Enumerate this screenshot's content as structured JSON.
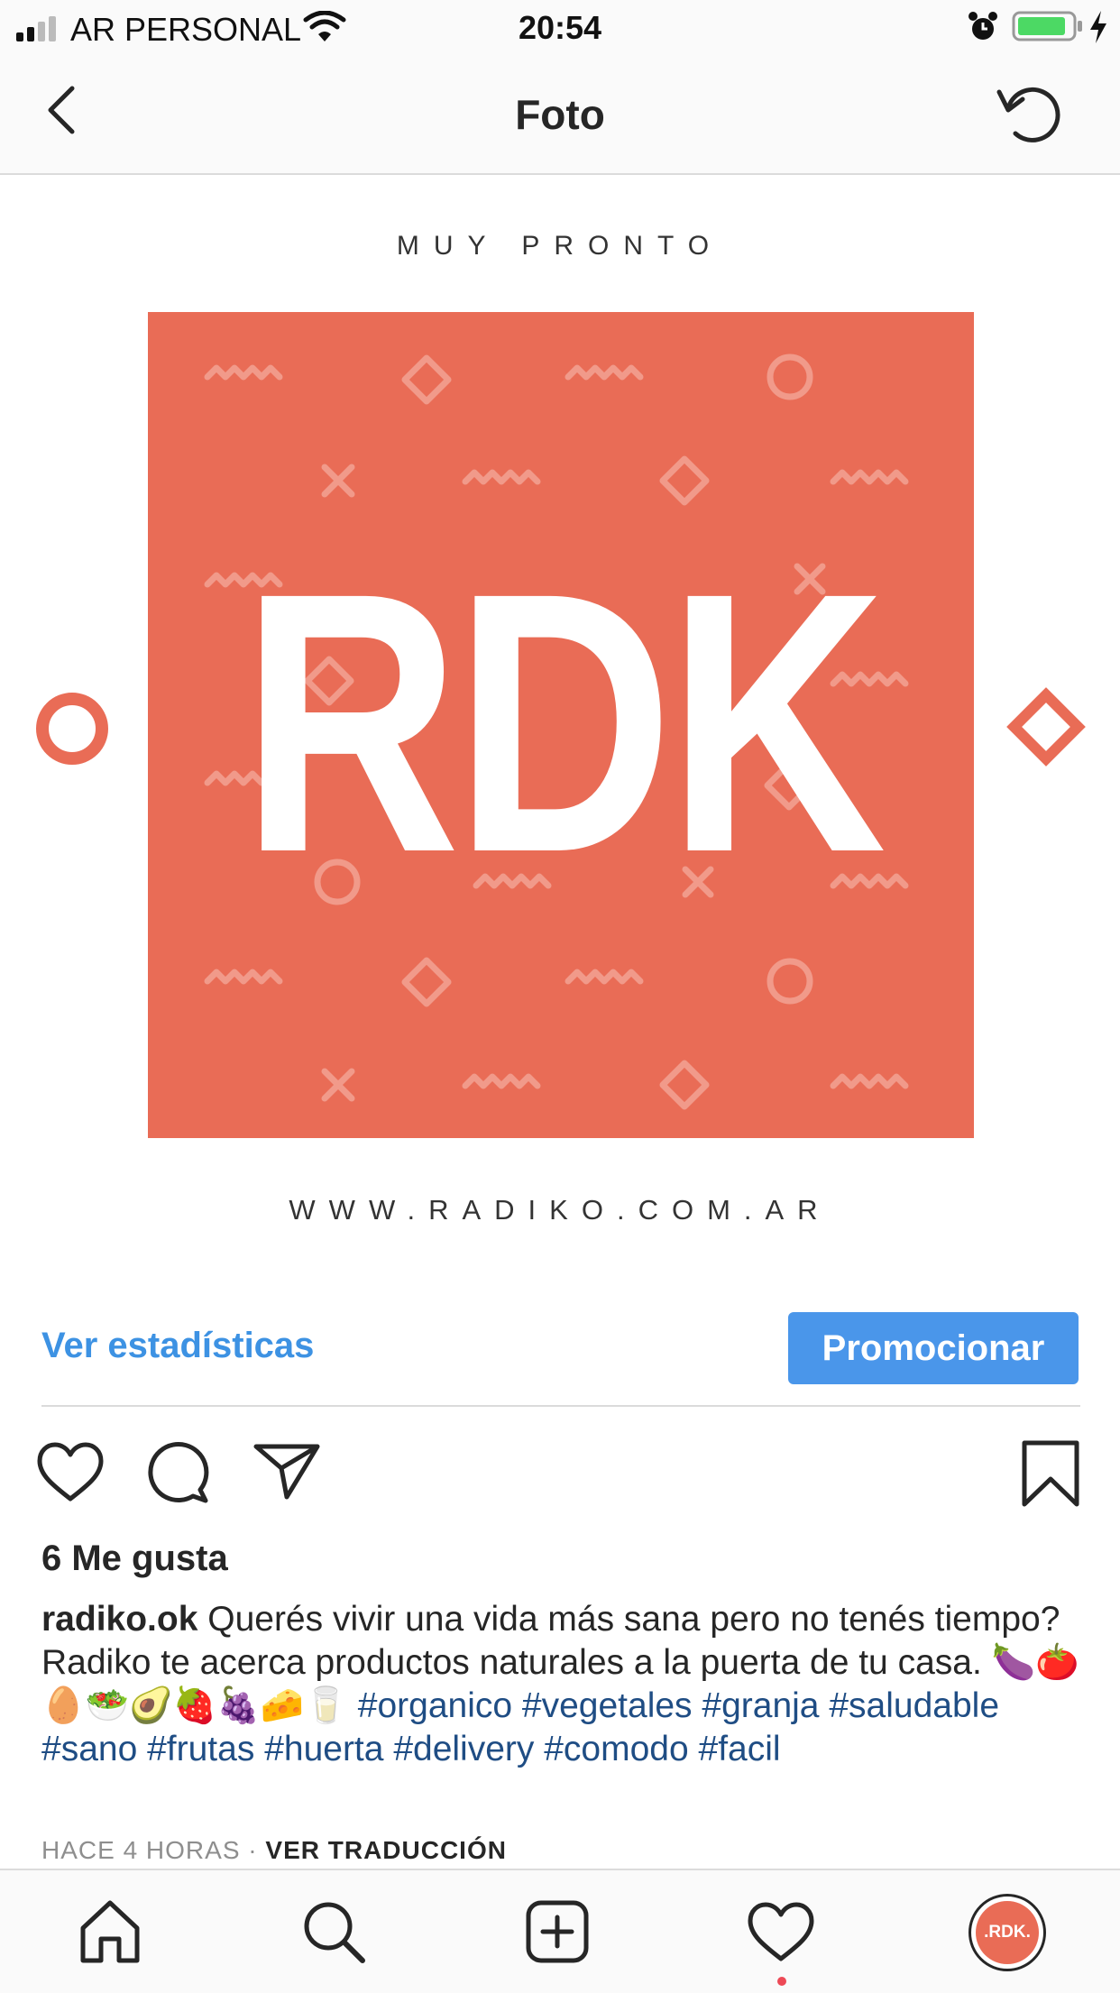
{
  "status_bar": {
    "carrier": "AR PERSONAL",
    "time": "20:54"
  },
  "header": {
    "title": "Foto"
  },
  "post_image": {
    "top_text": "MUY PRONTO",
    "logo_text": "RDK",
    "bottom_text": "WWW.RADIKO.COM.AR",
    "brand_color": "#e96c56"
  },
  "actions": {
    "stats_label": "Ver estadísticas",
    "promote_label": "Promocionar"
  },
  "likes": "6 Me gusta",
  "caption": {
    "username": "radiko.ok",
    "text": "Querés vivir una vida más sana pero no tenés tiempo? Radiko te acerca productos naturales a la puerta de tu casa. 🍆🍅🥚🥗🥑🍓🍇🧀🥛",
    "hashtags": [
      "#organico",
      "#vegetales",
      "#granja",
      "#saludable",
      "#sano",
      "#frutas",
      "#huerta",
      "#delivery",
      "#comodo",
      "#facil"
    ]
  },
  "timestamp": {
    "time_ago": "HACE 4 HORAS",
    "separator": " · ",
    "translate_label": "VER TRADUCCIÓN"
  },
  "tabbar": {
    "avatar_text": ".RDK."
  },
  "colors": {
    "link_blue": "#3d92e3",
    "button_blue": "#4a96ea",
    "hashtag": "#1f4d84",
    "notification": "#ed4956"
  }
}
